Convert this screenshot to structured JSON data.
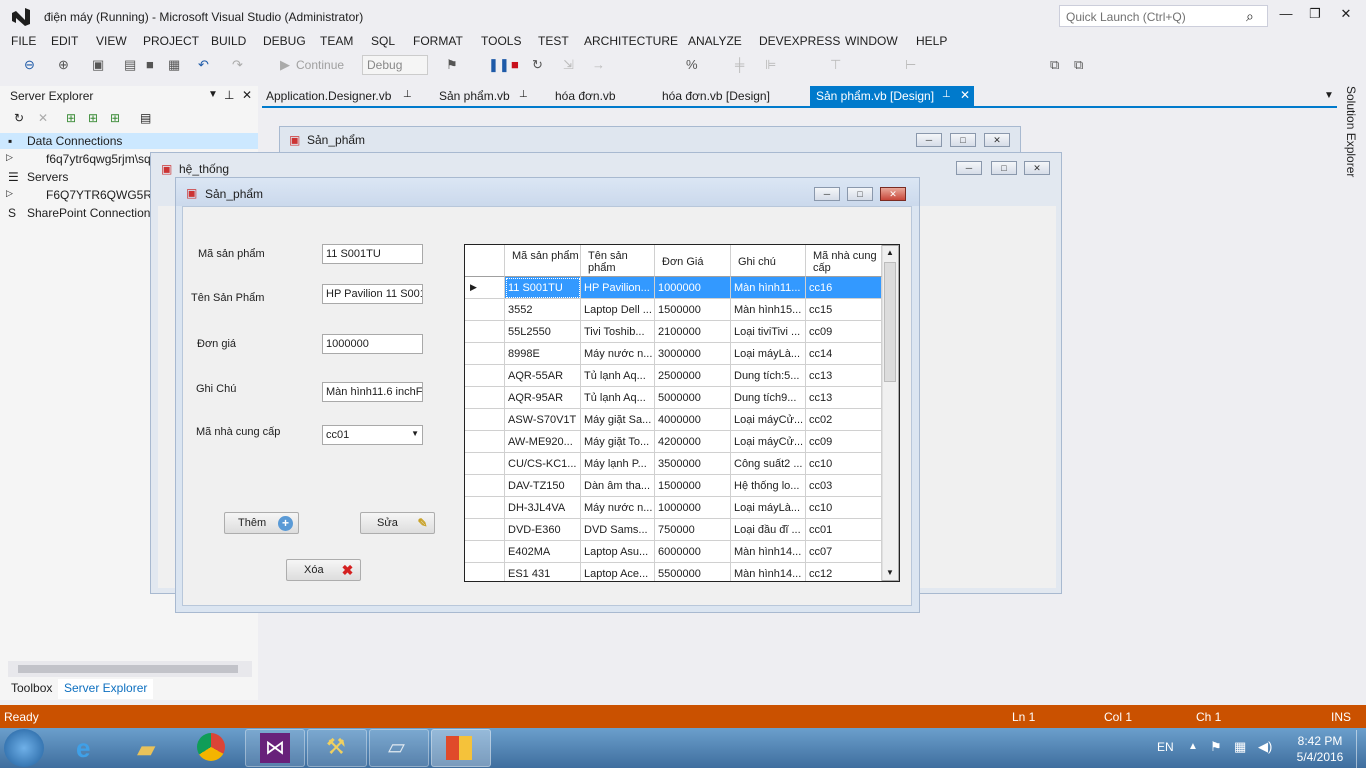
{
  "window": {
    "title": "điện máy (Running) - Microsoft Visual Studio (Administrator)",
    "quick_launch": "Quick Launch (Ctrl+Q)"
  },
  "menu": [
    "FILE",
    "EDIT",
    "VIEW",
    "PROJECT",
    "BUILD",
    "DEBUG",
    "TEAM",
    "SQL",
    "FORMAT",
    "TOOLS",
    "TEST",
    "ARCHITECTURE",
    "ANALYZE",
    "DEVEXPRESS",
    "WINDOW",
    "HELP"
  ],
  "toolbar": {
    "continue": "Continue",
    "config": "Debug"
  },
  "server_explorer": {
    "title": "Server Explorer",
    "items": [
      "Data Connections",
      "f6q7ytr6qwg5rjm\\sq",
      "Servers",
      "F6Q7YTR6QWG5RJM",
      "SharePoint Connections"
    ],
    "bottom_tabs": [
      "Toolbox",
      "Server Explorer"
    ]
  },
  "tabs": [
    "Application.Designer.vb",
    "Sản phẩm.vb",
    "hóa đơn.vb",
    "hóa đơn.vb [Design]",
    "Sản phẩm.vb [Design]"
  ],
  "solution_explorer": "Solution Explorer",
  "bg_windows": {
    "san_pham": "Sản_phẩm",
    "he_thong": "hệ_thống"
  },
  "form": {
    "title": "Sản_phẩm",
    "labels": {
      "ma_sp": "Mã sản phẩm",
      "ten_sp": "Tên Sản Phẩm",
      "don_gia": "Đơn giá",
      "ghi_chu": "Ghi Chú",
      "ma_ncc": "Mã nhà cung cấp"
    },
    "values": {
      "ma_sp": "11 S001TU",
      "ten_sp": "HP Pavilion 11 S001",
      "don_gia": "1000000",
      "ghi_chu": "Màn hình11.6 inchF",
      "ma_ncc": "cc01"
    },
    "buttons": {
      "them": "Thêm",
      "sua": "Sửa",
      "xoa": "Xóa"
    }
  },
  "grid": {
    "headers": [
      "Mã sản phẩm",
      "Tên sản phẩm",
      "Đơn Giá",
      "Ghi chú",
      "Mã nhà cung cấp"
    ],
    "rows": [
      [
        "11 S001TU",
        "HP Pavilion...",
        "1000000",
        "Màn hình11...",
        "cc16"
      ],
      [
        "3552",
        "Laptop Dell ...",
        "1500000",
        "Màn hình15...",
        "cc15"
      ],
      [
        "55L2550",
        "Tivi Toshib...",
        "2100000",
        "Loại tiviTivi ...",
        "cc09"
      ],
      [
        "8998E",
        "Máy nước n...",
        "3000000",
        "Loại máyLà...",
        "cc14"
      ],
      [
        "AQR-55AR",
        "Tủ lạnh Aq...",
        "2500000",
        "Dung tích:5...",
        "cc13"
      ],
      [
        "AQR-95AR",
        "Tủ lạnh Aq...",
        "5000000",
        "Dung tích9...",
        "cc13"
      ],
      [
        "ASW-S70V1T",
        "Máy giặt Sa...",
        "4000000",
        "Loại máyCử...",
        "cc02"
      ],
      [
        "AW-ME920...",
        "Máy giặt To...",
        "4200000",
        "Loại máyCử...",
        "cc09"
      ],
      [
        "CU/CS-KC1...",
        "Máy lạnh P...",
        "3500000",
        "Công suất2 ...",
        "cc10"
      ],
      [
        "DAV-TZ150",
        "Dàn âm tha...",
        "1500000",
        "Hệ thống lo...",
        "cc03"
      ],
      [
        "DH-3JL4VA",
        "Máy nước n...",
        "1000000",
        "Loại máyLà...",
        "cc10"
      ],
      [
        "DVD-E360",
        "DVD Sams...",
        "750000",
        "Loại đầu đĩ ...",
        "cc01"
      ],
      [
        "E402MA",
        "Laptop Asu...",
        "6000000",
        "Màn hình14...",
        "cc07"
      ],
      [
        "ES1 431",
        "Laptop Ace...",
        "5500000",
        "Màn hình14...",
        "cc12"
      ]
    ]
  },
  "status": {
    "ready": "Ready",
    "ln": "Ln 1",
    "col": "Col 1",
    "ch": "Ch 1",
    "ins": "INS"
  },
  "taskbar": {
    "lang": "EN",
    "time": "8:42 PM",
    "date": "5/4/2016"
  }
}
